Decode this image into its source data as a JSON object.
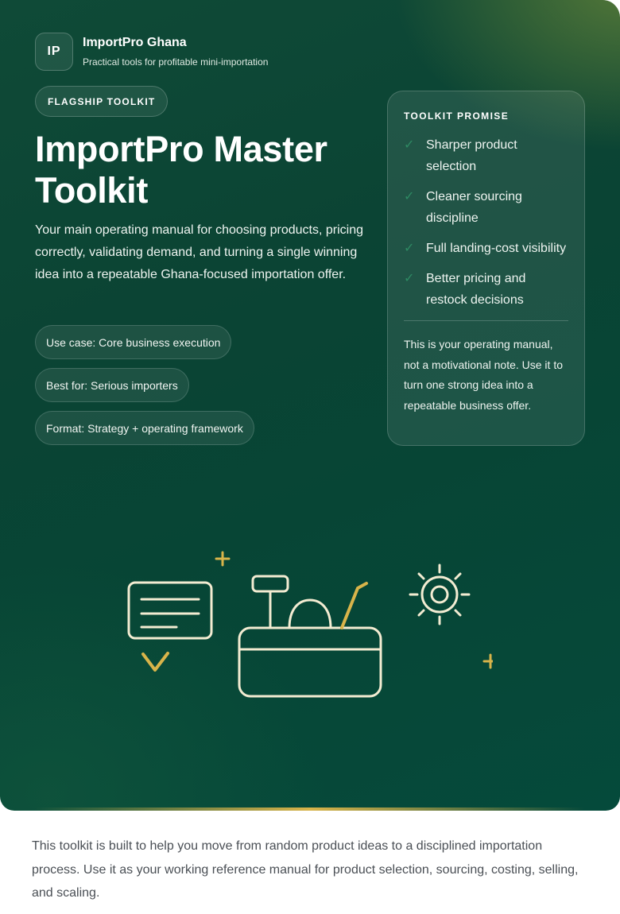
{
  "brand": {
    "mark": "IP",
    "name": "ImportPro Ghana",
    "tagline": "Practical tools for profitable mini-importation"
  },
  "hero": {
    "eyebrow": "FLAGSHIP TOOLKIT",
    "title": "ImportPro Master Toolkit",
    "lead": "Your main operating manual for choosing products, pricing correctly, validating demand, and turning a single winning idea into a repeatable Ghana-focused importation offer.",
    "pills": [
      "Use case: Core business execution",
      "Best for: Serious importers",
      "Format: Strategy + operating framework"
    ]
  },
  "promise": {
    "heading": "TOOLKIT PROMISE",
    "items": [
      "Sharper product selection",
      "Cleaner sourcing discipline",
      "Full landing-cost visibility",
      "Better pricing and restock decisions"
    ],
    "note": "This is your operating manual, not a motivational note. Use it to turn one strong idea into a repeatable business offer."
  },
  "intro": "This toolkit is built to help you move from random product ideas to a disciplined importation process. Use it as your working reference manual for product selection, sourcing, costing, selling, and scaling.",
  "icons": [
    "check-icon",
    "document-icon",
    "cash-register-icon",
    "sun-icon",
    "plus-icon"
  ],
  "colors": {
    "hero_dark": "#0b4434",
    "accent_gold": "#d8b44a",
    "illustration_stroke": "#f3ecd2",
    "check_green": "#2e8a63"
  }
}
